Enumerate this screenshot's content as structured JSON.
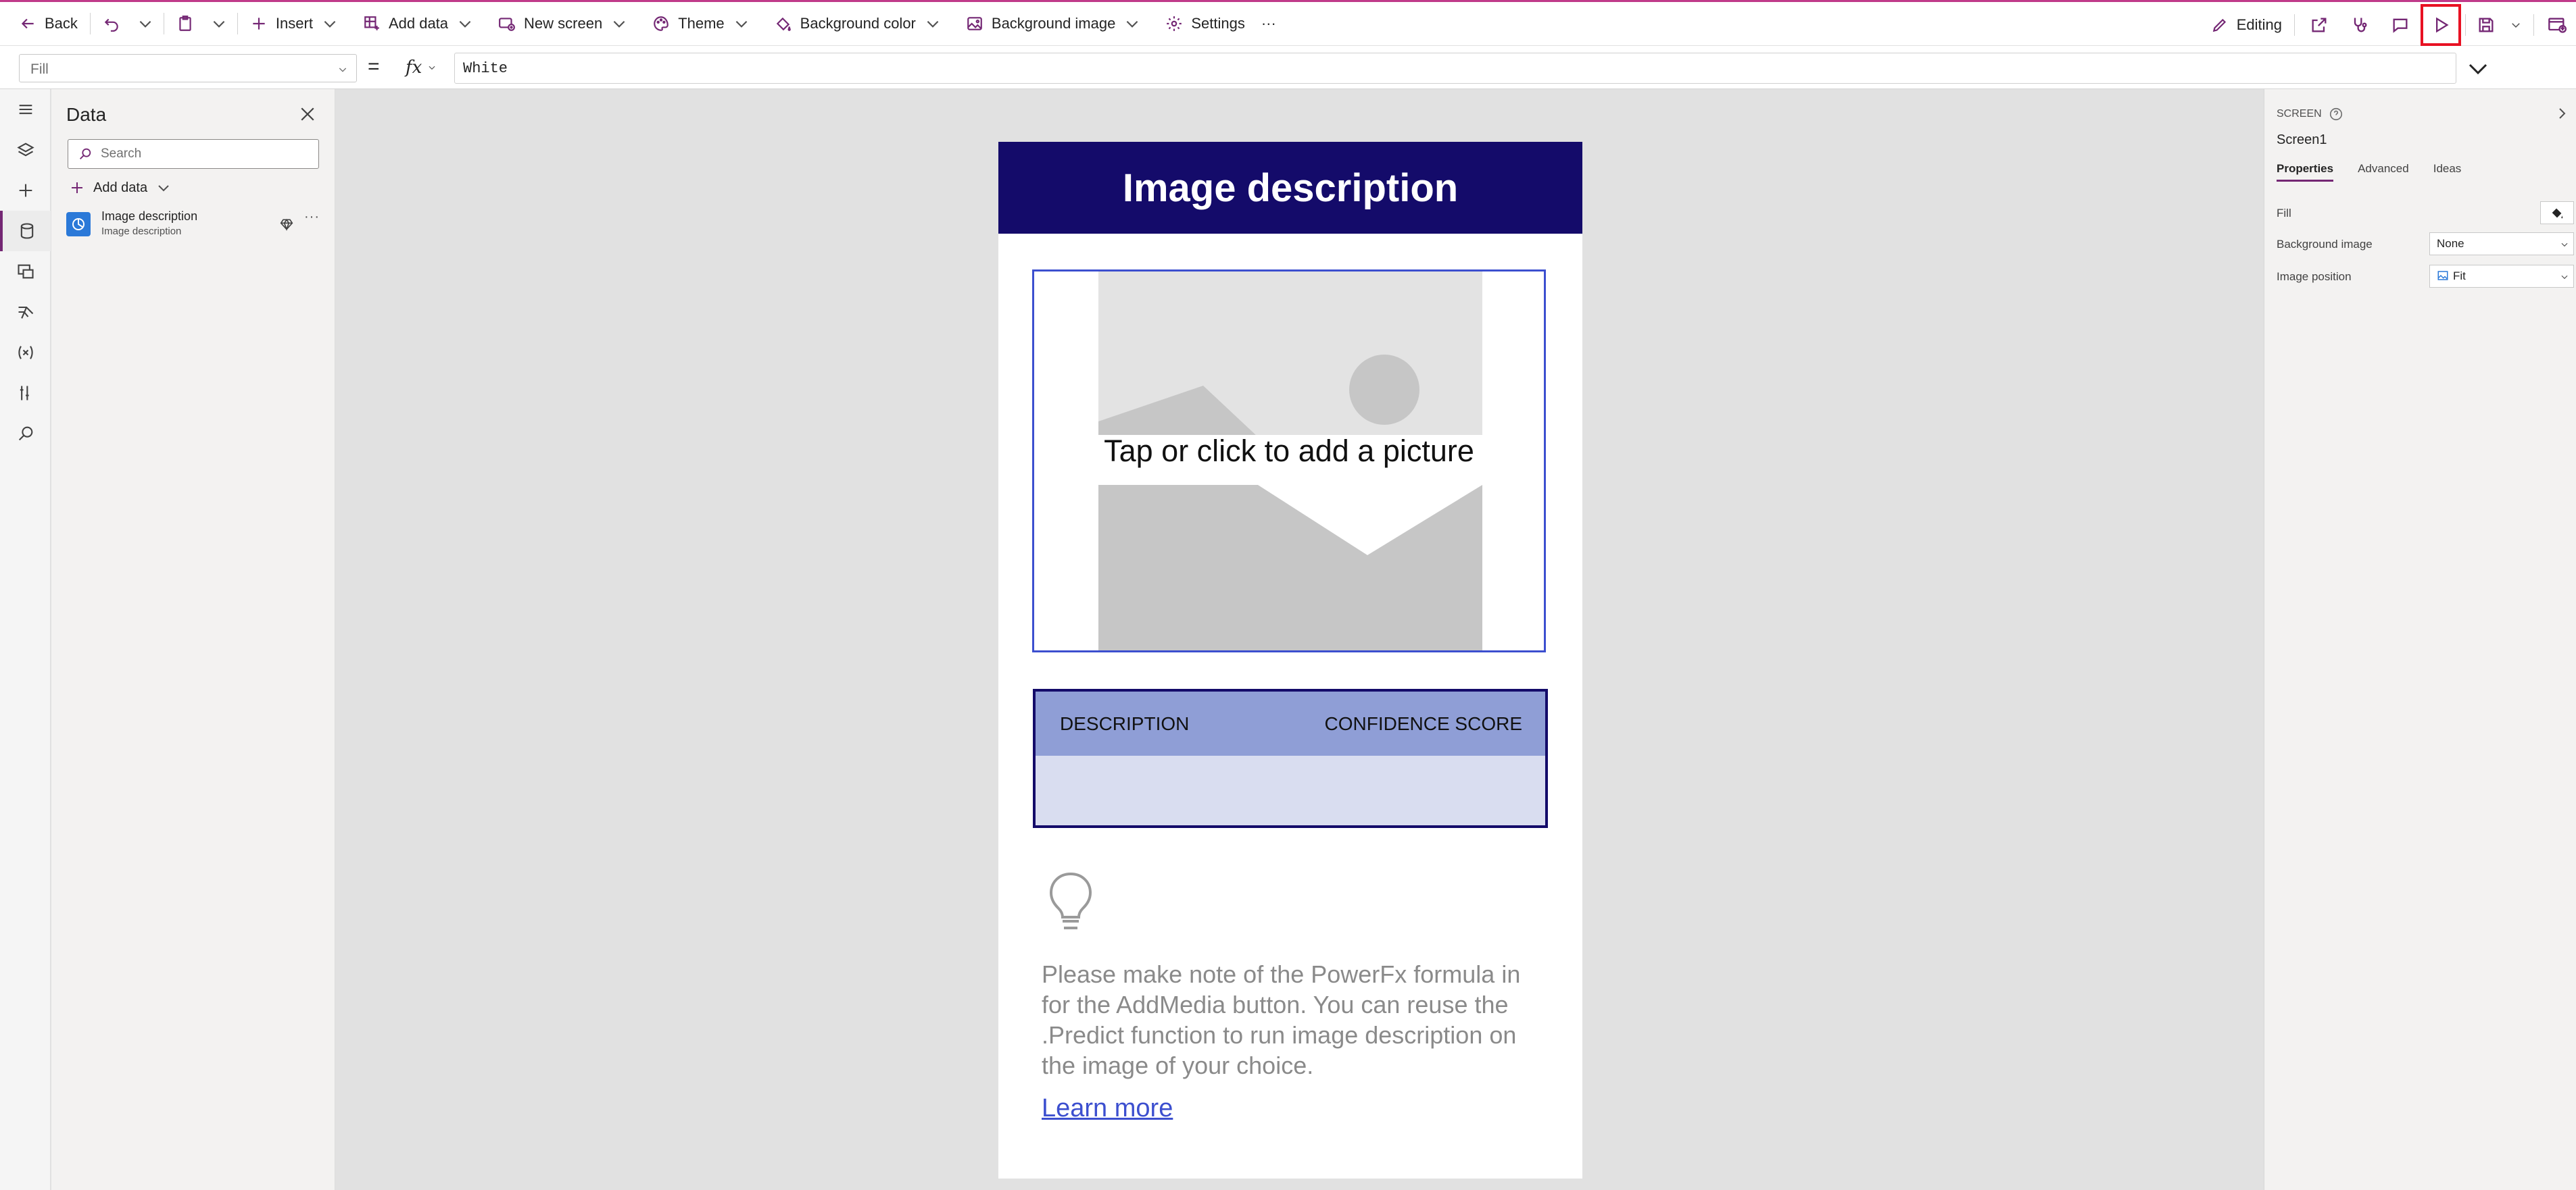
{
  "toolbar": {
    "back": "Back",
    "insert": "Insert",
    "add_data": "Add data",
    "new_screen": "New screen",
    "theme": "Theme",
    "background_color": "Background color",
    "background_image": "Background image",
    "settings": "Settings",
    "more": "···",
    "editing": "Editing"
  },
  "formula": {
    "property": "Fill",
    "equals": "=",
    "fx": "fx",
    "value": "White"
  },
  "data_panel": {
    "title": "Data",
    "search_placeholder": "Search",
    "add_data": "Add data",
    "item_title": "Image description",
    "item_subtitle": "Image description",
    "item_more": "···"
  },
  "canvas": {
    "header": "Image description",
    "add_picture": "Tap or click to add a picture",
    "col_description": "DESCRIPTION",
    "col_confidence": "CONFIDENCE SCORE",
    "tip": "Please make note of the PowerFx formula in for the AddMedia button. You can reuse the .Predict function to run image description on the image of your choice.",
    "learn_more": "Learn more"
  },
  "properties": {
    "type": "SCREEN",
    "name": "Screen1",
    "tabs": [
      "Properties",
      "Advanced",
      "Ideas"
    ],
    "fill_label": "Fill",
    "bg_image_label": "Background image",
    "bg_image_value": "None",
    "img_position_label": "Image position",
    "img_position_value": "Fit"
  },
  "colors": {
    "accent": "#742774",
    "header_bg": "#140b6a",
    "table_header": "#8f9ed6",
    "table_body": "#d9ddf0",
    "highlight": "#e81123"
  }
}
